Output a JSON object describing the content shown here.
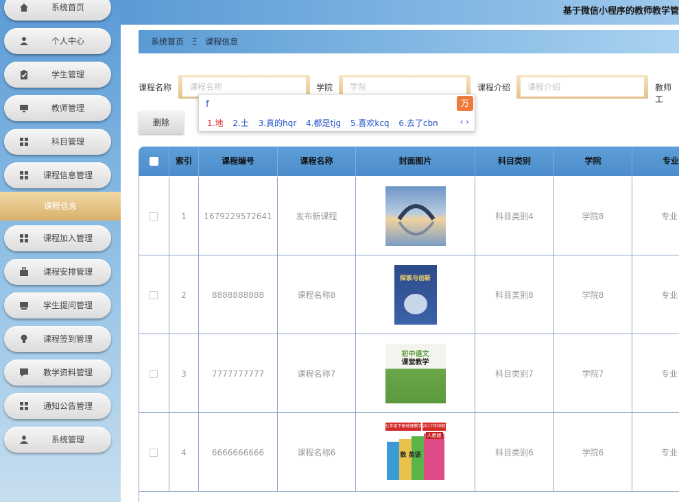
{
  "header": {
    "title": "基于微信小程序的教师教学管"
  },
  "sidebar": {
    "items": [
      {
        "label": "系统首页",
        "icon": "home-icon"
      },
      {
        "label": "个人中心",
        "icon": "user-icon"
      },
      {
        "label": "学生管理",
        "icon": "clipboard-icon"
      },
      {
        "label": "教师管理",
        "icon": "monitor-icon"
      },
      {
        "label": "科目管理",
        "icon": "grid-icon"
      },
      {
        "label": "课程信息管理",
        "icon": "grid-icon"
      },
      {
        "label": "课程加入管理",
        "icon": "grid-icon"
      },
      {
        "label": "课程安排管理",
        "icon": "briefcase-icon"
      },
      {
        "label": "学生提问管理",
        "icon": "monitor-icon"
      },
      {
        "label": "课程签到管理",
        "icon": "bulb-icon"
      },
      {
        "label": "教学资料管理",
        "icon": "chat-icon"
      },
      {
        "label": "通知公告管理",
        "icon": "grid-icon"
      },
      {
        "label": "系统管理",
        "icon": "user-icon"
      }
    ],
    "active_sub": "课程信息"
  },
  "breadcrumb": {
    "home": "系统首页",
    "separator": "Ξ",
    "current": "课程信息"
  },
  "search": {
    "course_name_label": "课程名称",
    "course_name_placeholder": "课程名称",
    "college_label": "学院",
    "college_placeholder": "学院",
    "intro_label": "课程介绍",
    "intro_placeholder": "课程介绍",
    "teacher_label": "教师工"
  },
  "toolbar": {
    "delete_label": "删除"
  },
  "ime": {
    "input": "f",
    "candidates": [
      "1.地",
      "2.土",
      "3.真的hqr",
      "4.都是tjg",
      "5.喜欢kcq",
      "6.去了cbn"
    ],
    "nav": "‹ ›"
  },
  "table": {
    "headers": [
      "索引",
      "课程编号",
      "课程名称",
      "封面图片",
      "科目类别",
      "学院",
      "专业"
    ],
    "rows": [
      {
        "index": "1",
        "code": "1679229572641",
        "name": "发布新课程",
        "category": "科目类别4",
        "college": "学院8",
        "major": "专业"
      },
      {
        "index": "2",
        "code": "8888888888",
        "name": "课程名称8",
        "category": "科目类别8",
        "college": "学院8",
        "major": "专业"
      },
      {
        "index": "3",
        "code": "7777777777",
        "name": "课程名称7",
        "category": "科目类别7",
        "college": "学院7",
        "major": "专业"
      },
      {
        "index": "4",
        "code": "6666666666",
        "name": "课程名称6",
        "category": "科目类别6",
        "college": "学院6",
        "major": "专业"
      }
    ],
    "cover_texts": {
      "row2_title": "探索与创新",
      "row3_title": "初中语文",
      "row3_sub": "课堂教学",
      "row4_banner": "七年级下册地理教学",
      "row4_tag": "2017年印刷",
      "row4_badge": "人教版",
      "row4_words": "数 英语"
    }
  }
}
